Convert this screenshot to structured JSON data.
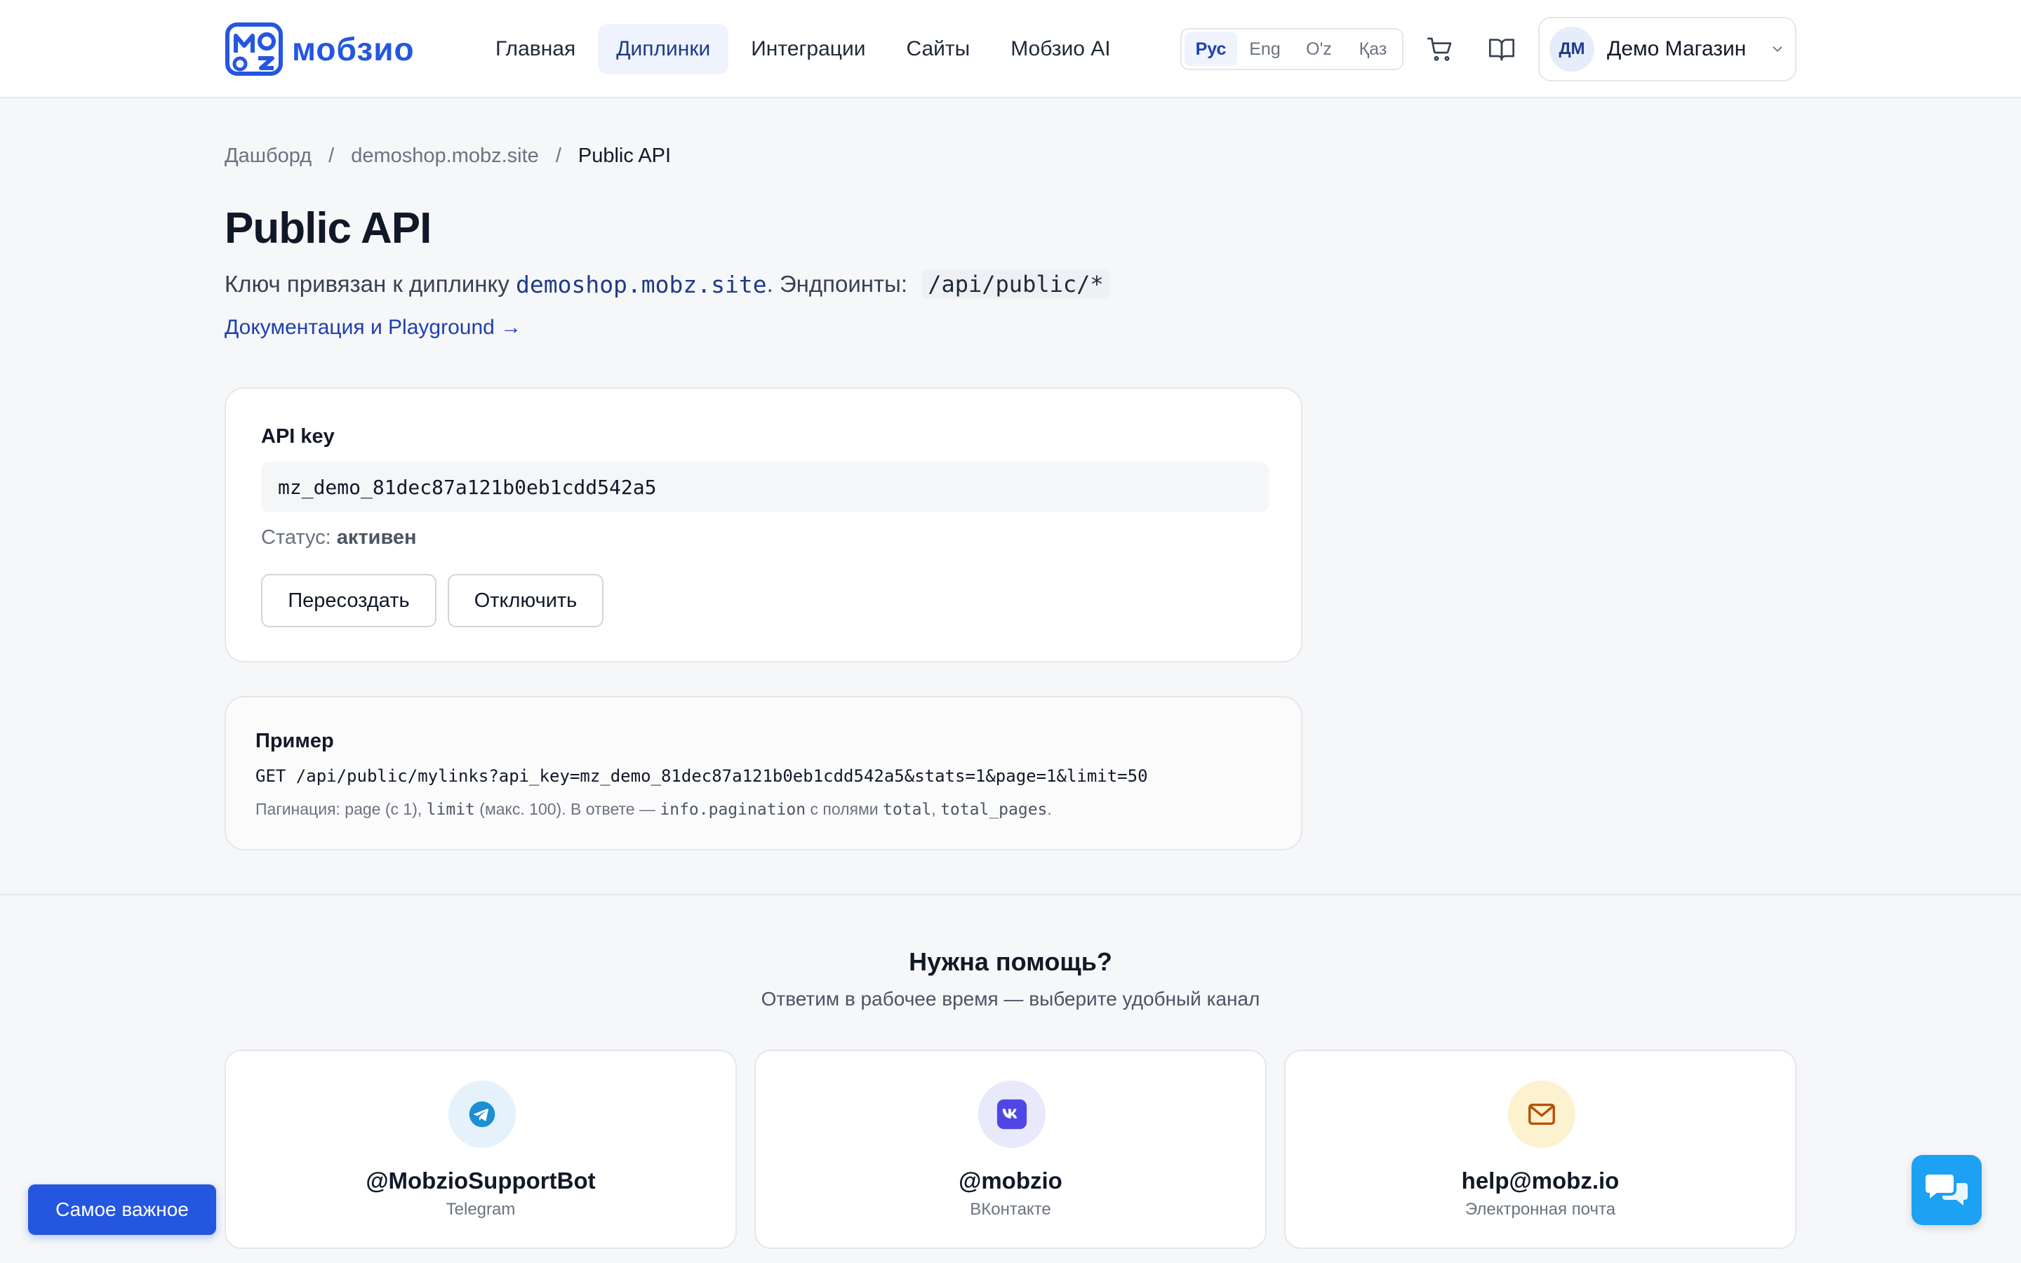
{
  "header": {
    "logo_text": "мобзио",
    "nav": [
      {
        "label": "Главная",
        "active": false
      },
      {
        "label": "Диплинки",
        "active": true
      },
      {
        "label": "Интеграции",
        "active": false
      },
      {
        "label": "Сайты",
        "active": false
      },
      {
        "label": "Мобзио AI",
        "active": false
      }
    ],
    "languages": [
      {
        "label": "Рус",
        "active": true
      },
      {
        "label": "Eng",
        "active": false
      },
      {
        "label": "O'z",
        "active": false
      },
      {
        "label": "Қаз",
        "active": false
      }
    ],
    "user": {
      "initials": "ДМ",
      "name": "Демо Магазин"
    }
  },
  "breadcrumb": {
    "items": [
      "Дашборд",
      "demoshop.mobz.site",
      "Public API"
    ],
    "separator": "/"
  },
  "page": {
    "title": "Public API",
    "subtitle_prefix": "Ключ привязан к диплинку ",
    "subtitle_link": "demoshop.mobz.site",
    "subtitle_mid": ". Эндпоинты: ",
    "subtitle_code": "/api/public/*",
    "docs_link": "Документация и Playground →"
  },
  "api_card": {
    "label": "API key",
    "key": "mz_demo_81dec87a121b0eb1cdd542a5",
    "status_label": "Статус: ",
    "status_value": "активен",
    "regenerate_button": "Пересоздать",
    "disable_button": "Отключить"
  },
  "example": {
    "title": "Пример",
    "code": "GET /api/public/mylinks?api_key=mz_demo_81dec87a121b0eb1cdd542a5&stats=1&page=1&limit=50",
    "note_parts": [
      "Пагинация: page (с 1), ",
      "limit",
      " (макс. 100). В ответе — ",
      "info.pagination",
      " с полями ",
      "total",
      ", ",
      "total_pages",
      "."
    ]
  },
  "help": {
    "title": "Нужна помощь?",
    "subtitle": "Ответим в рабочее время — выберите удобный канал",
    "channels": [
      {
        "main": "@MobzioSupportBot",
        "sub": "Telegram",
        "icon": "telegram-icon",
        "bg": "#e6f2fb",
        "color": "#1d8fd3"
      },
      {
        "main": "@mobzio",
        "sub": "ВКонтакте",
        "icon": "vk-icon",
        "bg": "#e8e9fb",
        "color": "#4f46e5"
      },
      {
        "main": "help@mobz.io",
        "sub": "Электронная почта",
        "icon": "mail-icon",
        "bg": "#fdf2cf",
        "color": "#b45309"
      }
    ]
  },
  "floating": {
    "important_button": "Самое важное"
  },
  "colors": {
    "accent": "#2456e0",
    "link": "#1e40af",
    "chat": "#1da1f2"
  }
}
